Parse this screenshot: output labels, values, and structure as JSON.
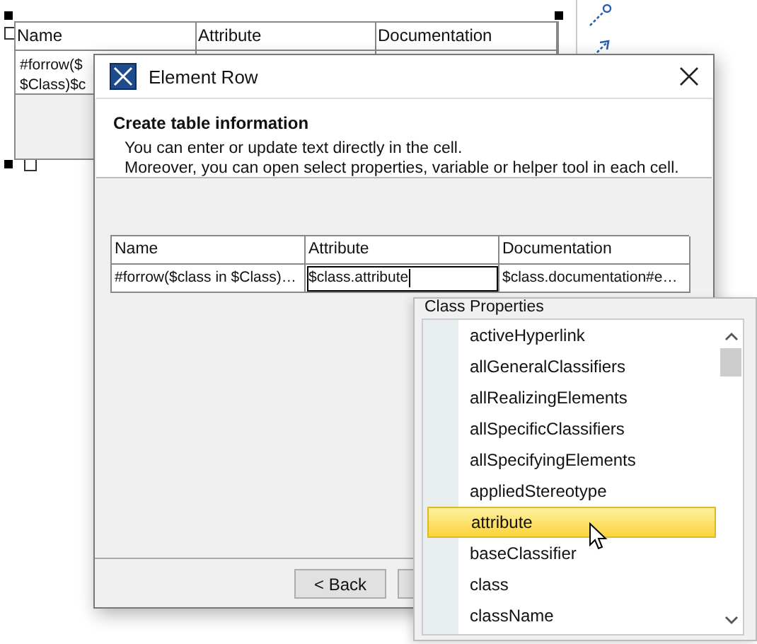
{
  "diagram_table": {
    "columns": [
      "Name",
      "Attribute",
      "Documentation"
    ],
    "cell_lines": [
      "#forrow($",
      "$Class)$c"
    ]
  },
  "dialog": {
    "title": "Element Row",
    "heading": "Create table information",
    "description": [
      "You can enter or update text directly in the cell.",
      "Moreover, you can open select properties, variable or helper tool in each cell."
    ],
    "table": {
      "columns": [
        "Name",
        "Attribute",
        "Documentation"
      ],
      "row": [
        {
          "kind": "text",
          "value": "#forrow($class in $Class)…"
        },
        {
          "kind": "edit",
          "value": "$class.attribute"
        },
        {
          "kind": "text",
          "value": "$class.documentation#e…"
        }
      ]
    },
    "buttons": [
      "< Back"
    ]
  },
  "popup": {
    "title": "Class Properties",
    "items": [
      {
        "label": "activeHyperlink",
        "selected": false
      },
      {
        "label": "allGeneralClassifiers",
        "selected": false
      },
      {
        "label": "allRealizingElements",
        "selected": false
      },
      {
        "label": "allSpecificClassifiers",
        "selected": false
      },
      {
        "label": "allSpecifyingElements",
        "selected": false
      },
      {
        "label": "appliedStereotype",
        "selected": false
      },
      {
        "label": "attribute",
        "selected": true
      },
      {
        "label": "baseClassifier",
        "selected": false
      },
      {
        "label": "class",
        "selected": false
      },
      {
        "label": "className",
        "selected": false
      }
    ]
  }
}
